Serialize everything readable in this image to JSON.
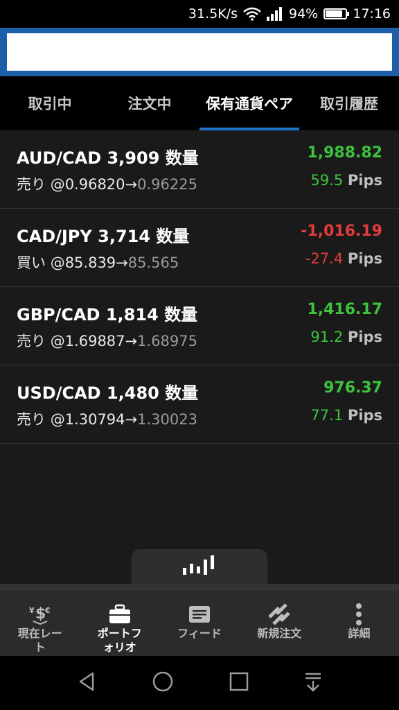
{
  "status_bar": {
    "speed": "31.5K/s",
    "battery": "94%",
    "time": "17:16"
  },
  "tabs": [
    {
      "label": "取引中"
    },
    {
      "label": "注文中"
    },
    {
      "label": "保有通貨ペア"
    },
    {
      "label": "取引履歴"
    }
  ],
  "positions": [
    {
      "pair": "AUD/CAD",
      "qty": "3,909",
      "qty_label": "数量",
      "side": "売り",
      "entry": "@0.96820→",
      "current": "0.96225",
      "pl": "1,988.82",
      "pips": "59.5",
      "pips_unit": "Pips",
      "status": "pos"
    },
    {
      "pair": "CAD/JPY",
      "qty": "3,714",
      "qty_label": "数量",
      "side": "買い",
      "entry": "@85.839→",
      "current": "85.565",
      "pl": "-1,016.19",
      "pips": "-27.4",
      "pips_unit": "Pips",
      "status": "neg"
    },
    {
      "pair": "GBP/CAD",
      "qty": "1,814",
      "qty_label": "数量",
      "side": "売り",
      "entry": "@1.69887→",
      "current": "1.68975",
      "pl": "1,416.17",
      "pips": "91.2",
      "pips_unit": "Pips",
      "status": "pos"
    },
    {
      "pair": "USD/CAD",
      "qty": "1,480",
      "qty_label": "数量",
      "side": "売り",
      "entry": "@1.30794→",
      "current": "1.30023",
      "pl": "976.37",
      "pips": "77.1",
      "pips_unit": "Pips",
      "status": "pos"
    }
  ],
  "bottom_nav": [
    {
      "label_line1": "現在レー",
      "label_line2": "ト",
      "icon": "currency-rates-icon"
    },
    {
      "label_line1": "ポートフ",
      "label_line2": "ォリオ",
      "icon": "briefcase-icon"
    },
    {
      "label_line1": "フィード",
      "label_line2": "",
      "icon": "feed-icon"
    },
    {
      "label_line1": "新規注文",
      "label_line2": "",
      "icon": "new-order-icon"
    },
    {
      "label_line1": "詳細",
      "label_line2": "",
      "icon": "more-vertical-icon"
    }
  ],
  "colors": {
    "accent": "#1e73c8",
    "header": "#1d5fa8",
    "positive": "#3cc43c",
    "negative": "#e43b3b"
  },
  "battery_level": 0.94
}
